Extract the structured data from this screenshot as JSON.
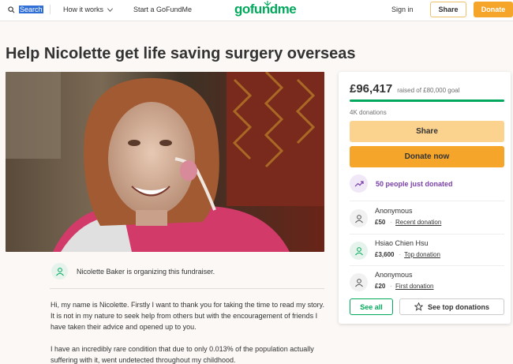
{
  "header": {
    "search_label": "Search",
    "how_it_works_label": "How it works",
    "start_label": "Start a GoFundMe",
    "logo_text": "gofundme",
    "sign_in_label": "Sign in",
    "share_label": "Share",
    "donate_label": "Donate"
  },
  "campaign": {
    "title": "Help Nicolette get life saving surgery overseas",
    "organizer_text": "Nicolette Baker is organizing this fundraiser.",
    "story": [
      "Hi, my name is Nicolette. Firstly I want to thank you for taking the time to read my story. It is not in my nature to seek help from others but with the encouragement of friends I have taken their advice and opened up to you.",
      "I have an incredibly rare condition that due to only 0.013% of the population actually suffering with it, went undetected throughout my childhood."
    ]
  },
  "card": {
    "raised_amount": "£96,417",
    "raised_goal": "raised of £80,000 goal",
    "progress_fraction": 1.0,
    "donation_count": "4K donations",
    "share_label": "Share",
    "donate_label": "Donate now",
    "trend_text": "50 people just donated",
    "donors": [
      {
        "name": "Anonymous",
        "amount": "£50",
        "tag": "Recent donation"
      },
      {
        "name": "Hsiao Chien Hsu",
        "amount": "£3,600",
        "tag": "Top donation"
      },
      {
        "name": "Anonymous",
        "amount": "£20",
        "tag": "First donation"
      }
    ],
    "see_all_label": "See all",
    "see_top_label": "See top donations"
  },
  "colors": {
    "brand_green": "#02a95c",
    "donate_orange": "#f5a52a",
    "share_yellow": "#fbd38f",
    "trend_purple": "#7a3fa8"
  },
  "icons": [
    "search-icon",
    "chevron-down-icon",
    "user-icon",
    "trend-up-icon",
    "star-icon"
  ]
}
